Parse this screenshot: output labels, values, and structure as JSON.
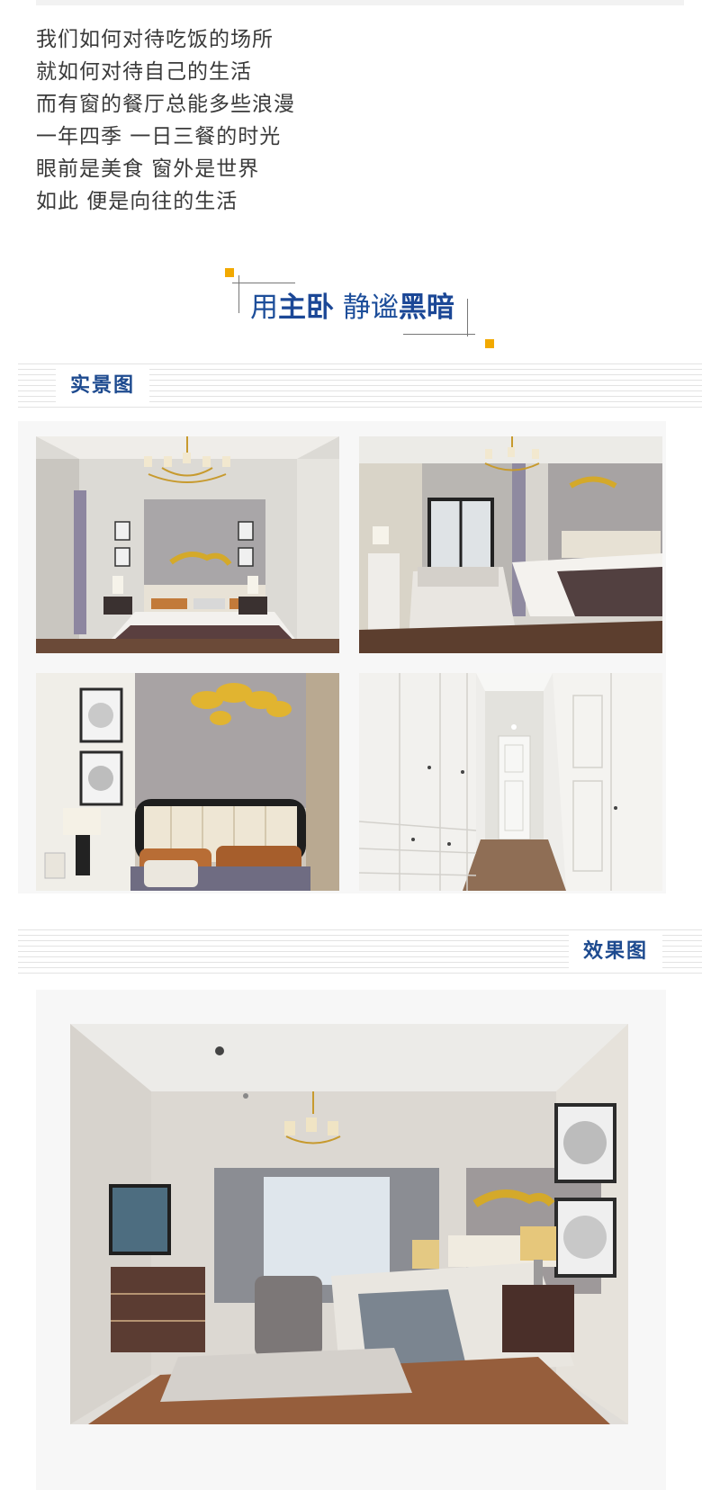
{
  "poem": {
    "lines": [
      "我们如何对待吃饭的场所",
      "就如何对待自己的生活",
      "而有窗的餐厅总能多些浪漫",
      "一年四季 一日三餐的时光",
      "眼前是美食 窗外是世界",
      "如此 便是向往的生活"
    ]
  },
  "section_heading": {
    "prefix": "用",
    "bold_1": "主卧",
    "middle": " 静谧",
    "bold_2": "黑暗"
  },
  "bars": {
    "real_photos": "实景图",
    "renderings": "效果图"
  },
  "colors": {
    "accent_blue": "#1d4a8f",
    "accent_yellow": "#f2a900"
  }
}
